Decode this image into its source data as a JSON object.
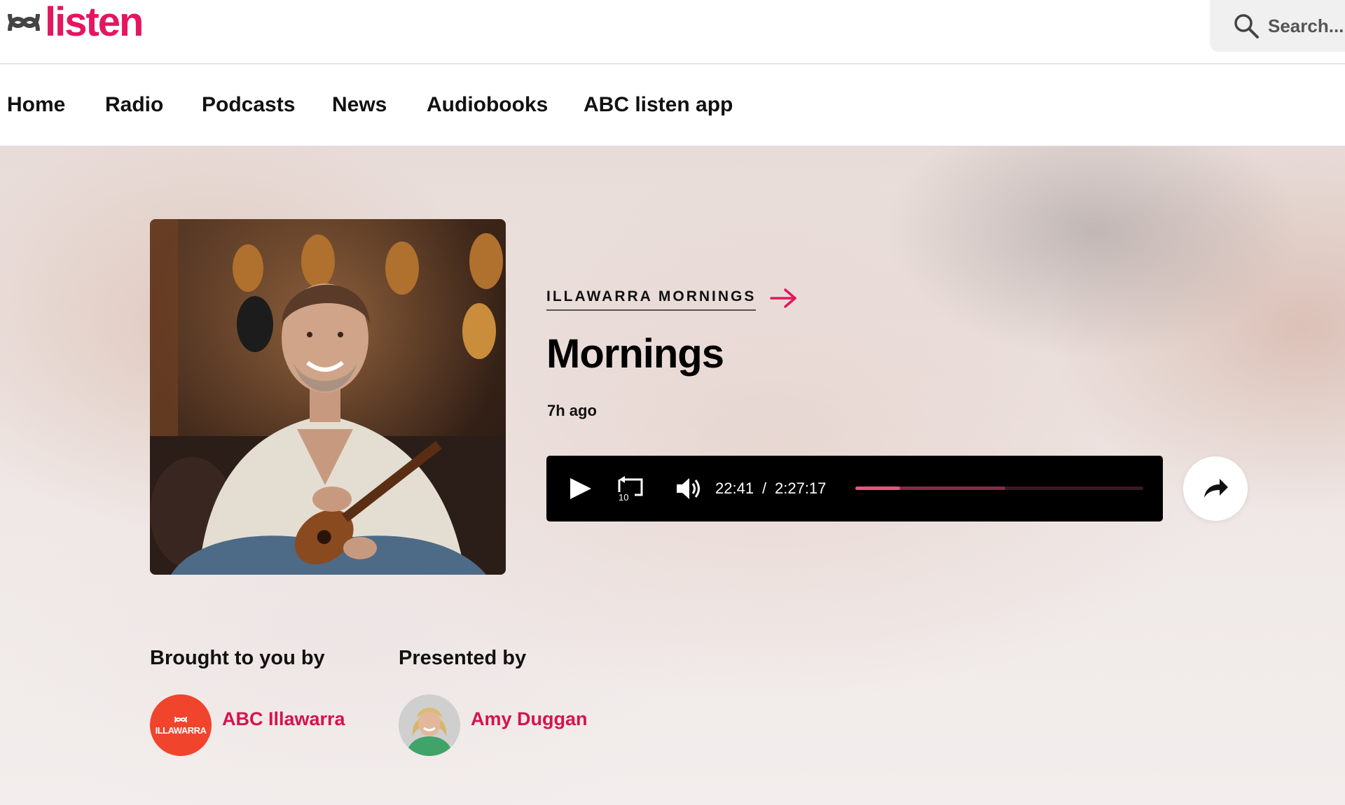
{
  "header": {
    "logo_text": "listen",
    "search_placeholder": "Search..."
  },
  "nav": {
    "items": [
      {
        "label": "Home"
      },
      {
        "label": "Radio"
      },
      {
        "label": "Podcasts"
      },
      {
        "label": "News"
      },
      {
        "label": "Audiobooks"
      },
      {
        "label": "ABC listen app"
      }
    ]
  },
  "episode": {
    "program_link": "ILLAWARRA MORNINGS",
    "title": "Mornings",
    "published": "7h ago"
  },
  "player": {
    "current_time": "22:41",
    "separator": "/",
    "duration": "2:27:17",
    "progress_fraction": 0.155,
    "buffered_fraction": 0.52,
    "rewind_seconds": "10"
  },
  "credits": {
    "brought_heading": "Brought to you by",
    "station_name": "ABC Illawarra",
    "station_badge": "ILLAWARRA",
    "presented_heading": "Presented by",
    "presenter_name": "Amy Duggan"
  },
  "colors": {
    "brand": "#e4165f",
    "link": "#d6124f",
    "progress": "#e9547f",
    "station_badge": "#f0442c"
  }
}
